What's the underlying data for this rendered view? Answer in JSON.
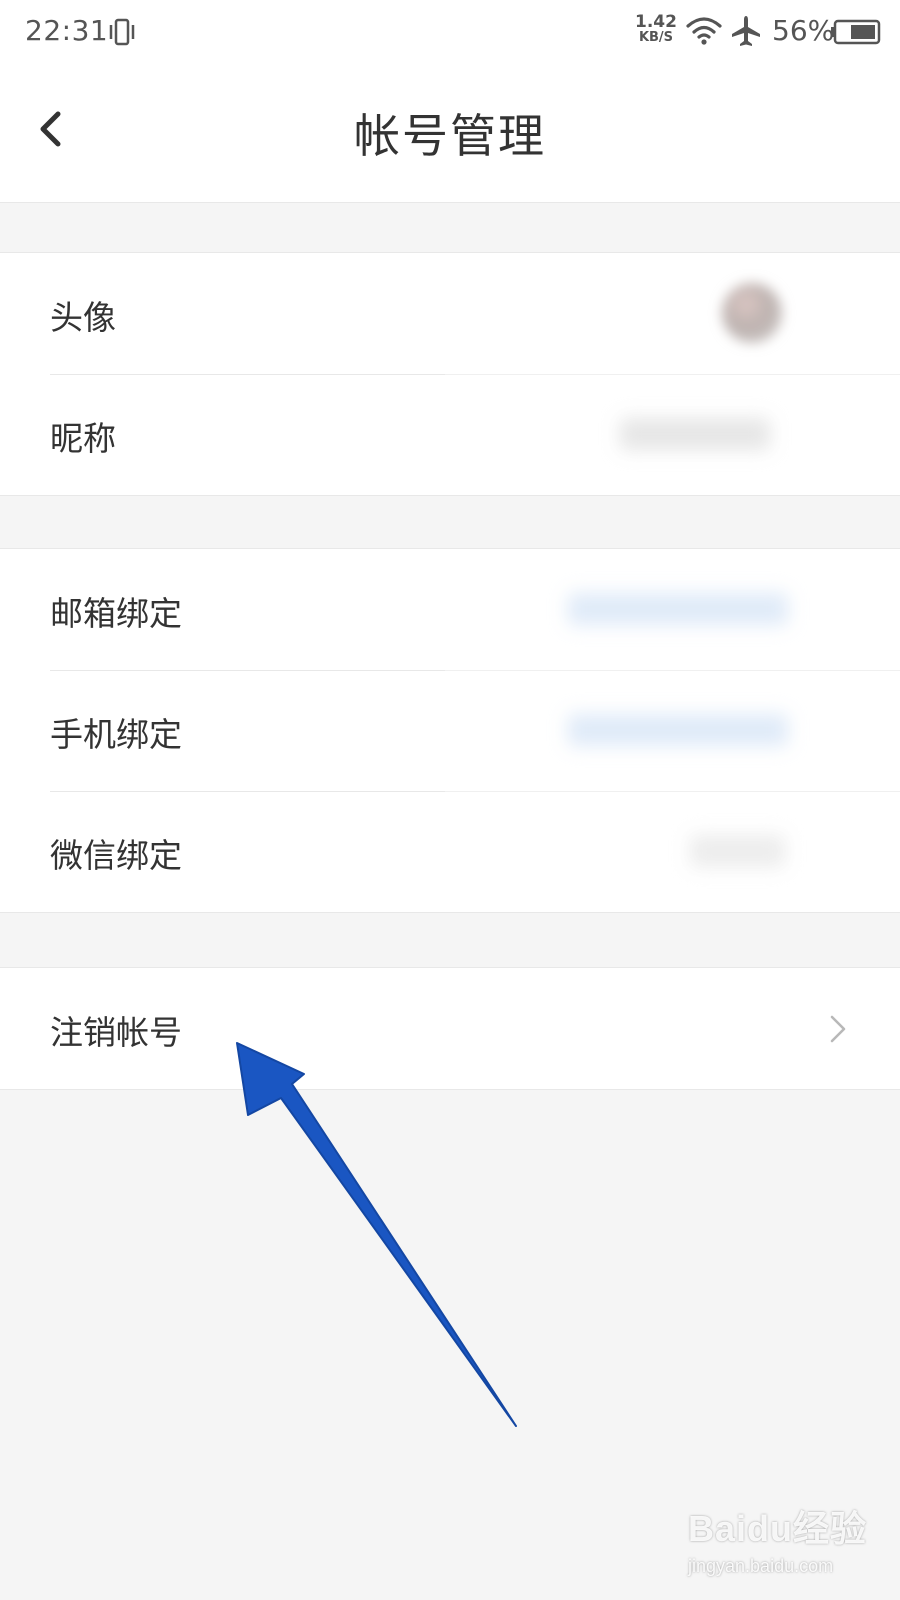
{
  "status_bar": {
    "time": "22:31",
    "net_speed_value": "1.42",
    "net_speed_unit": "KB/S",
    "battery_percent": "56%",
    "icons": [
      "vibrate-icon",
      "wifi-icon",
      "airplane-icon",
      "battery-icon"
    ]
  },
  "header": {
    "title": "帐号管理",
    "back_icon": "chevron-left-icon"
  },
  "groups": {
    "profile": {
      "items": [
        {
          "label": "头像"
        },
        {
          "label": "昵称"
        }
      ]
    },
    "bindings": {
      "items": [
        {
          "label": "邮箱绑定"
        },
        {
          "label": "手机绑定"
        },
        {
          "label": "微信绑定"
        }
      ]
    },
    "danger": {
      "items": [
        {
          "label": "注销帐号",
          "icon": "chevron-right-icon"
        }
      ]
    }
  },
  "annotation": {
    "arrow_color": "#1a56c2",
    "points_to": "注销帐号"
  },
  "watermark": {
    "brand": "Baidu经验",
    "url": "jingyan.baidu.com"
  },
  "colors": {
    "background": "#f5f5f5",
    "surface": "#ffffff",
    "text": "#333333",
    "divider": "#e8e8e8",
    "blurred_link": "#cfe0f5"
  }
}
